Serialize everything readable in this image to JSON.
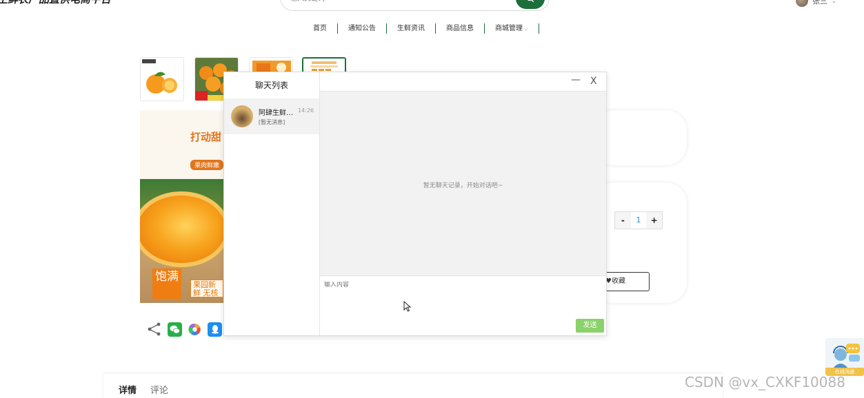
{
  "header": {
    "site_title": "生鲜农产品直供电商平台",
    "search_placeholder": "输入关键词",
    "user_name": "张三"
  },
  "nav": {
    "items": [
      {
        "label": "首页"
      },
      {
        "label": "通知公告"
      },
      {
        "label": "生鲜资讯"
      },
      {
        "label": "商品信息"
      },
      {
        "label": "商城管理",
        "has_dropdown": true
      }
    ]
  },
  "product": {
    "promo_title": "打动甜",
    "promo_pill": "果肉鲜嫩",
    "tag_full": "饱满",
    "tag_fresh": "果园新鲜 无核化",
    "quantity": "1",
    "stepper_minus": "-",
    "stepper_plus": "+",
    "favorite_label": "收藏"
  },
  "chat": {
    "list_title": "聊天列表",
    "conversations": [
      {
        "name": "阿肆生鲜店铺",
        "time": "14:26",
        "last_message": "[暂无消息]"
      }
    ],
    "minimize_label": "—",
    "close_label": "X",
    "empty_message": "暂无聊天记录，开始对话吧~",
    "input_placeholder": "输入内容",
    "send_label": "发送"
  },
  "tabs": [
    {
      "label": "详情",
      "active": true
    },
    {
      "label": "评论",
      "active": false
    }
  ],
  "online_service": {
    "label": "在线沟通"
  },
  "watermark": "CSDN @vx_CXKF10088",
  "colors": {
    "brand_green": "#1b6f3a",
    "send_green": "#8bd26a",
    "orange": "#e0751c"
  }
}
